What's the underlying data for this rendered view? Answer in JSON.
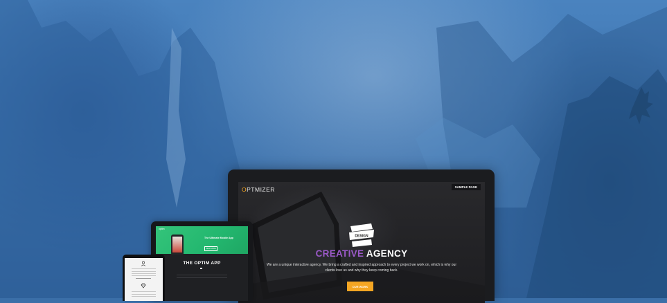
{
  "desktop": {
    "logo_first_letter": "O",
    "logo_rest": "PTMIZER",
    "nav_button": "SAMPLE PAGE",
    "hero_title_accent": "CREATIVE",
    "hero_title_rest": "AGENCY",
    "hero_text": "We are a unique interactive agency. We bring a crafted and inspired approach to every project we work on, which is why our clients love us and why they keep coming back.",
    "cta_button": "OUR WORK",
    "badge_text": "DESIGN"
  },
  "tablet": {
    "logo": "optim",
    "headline_part1": "The Ultimate",
    "headline_bold": "Mobile",
    "headline_part2": "App",
    "cta": "READ MORE",
    "section_title": "THE OPTIM APP"
  },
  "colors": {
    "accent_orange": "#f5a623",
    "accent_purple": "#9b59c8",
    "tablet_green": "#2abf74"
  }
}
